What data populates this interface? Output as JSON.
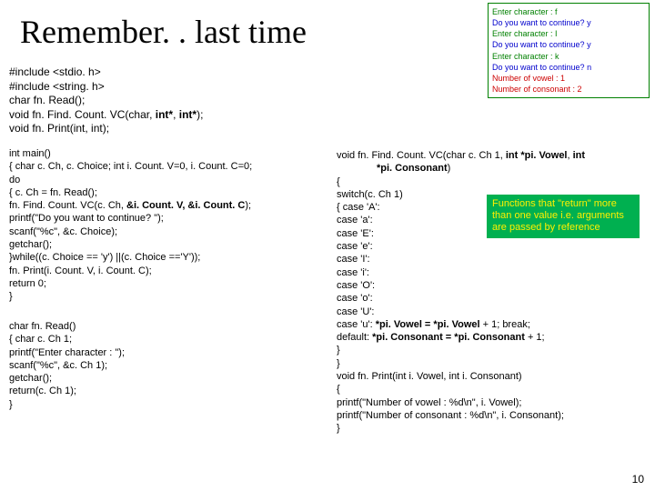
{
  "title": "Remember. . last time",
  "output": {
    "l1": "Enter character : f",
    "l2": "Do you want to continue? y",
    "l3": "Enter character : I",
    "l4": "Do you want to continue? y",
    "l5": "Enter character : k",
    "l6": "Do you want to continue? n",
    "l7": "Number of vowel : 1",
    "l8": "Number of consonant : 2"
  },
  "decl": {
    "l1": "#include <stdio. h>",
    "l2": "#include <string. h>",
    "l3": "char fn. Read();",
    "l4a": "void fn. Find. Count. VC(char, ",
    "l4b": "int*",
    "l4c": ", ",
    "l4d": "int*",
    "l4e": ");",
    "l5": "void fn. Print(int, int);"
  },
  "main": {
    "l1": "int main()",
    "l2": "{   char c. Ch, c. Choice; int i. Count. V=0, i. Count. C=0;",
    "l3": "      do",
    "l4": "      {   c. Ch = fn. Read();",
    "l5a": "          fn. Find. Count. VC(c. Ch, ",
    "l5b": "&i. Count. V, &i. Count. C",
    "l5c": ");",
    "l6": "          printf(\"Do you want to continue? \");",
    "l7": "          scanf(\"%c\", &c. Choice);",
    "l8": "          getchar();",
    "l9": "      }while((c. Choice == 'y') ||(c. Choice =='Y'));",
    "l10": "      fn. Print(i. Count. V, i. Count. C);",
    "l11": "      return 0;",
    "l12": "}"
  },
  "read": {
    "l1": "char fn. Read()",
    "l2": "{    char c. Ch 1;",
    "l3": "      printf(\"Enter character : \");",
    "l4": "      scanf(\"%c\", &c. Ch 1);",
    "l5": "      getchar();",
    "l6": "      return(c. Ch 1);",
    "l7": "}"
  },
  "right": {
    "sig1": "void fn. Find. Count. VC(char c. Ch 1, ",
    "sig2": "int *pi. Vowel",
    "sig3": ", ",
    "sig4": "int",
    "sig5": "*pi. Consonant",
    "sig6": ")",
    "l2": "{",
    "l3": "       switch(c. Ch 1)",
    "l4": "       {     case 'A':",
    "l5": "              case 'a':",
    "l6": "              case 'E':",
    "l7": "              case 'e':",
    "l8": "              case 'I':",
    "l9": "              case 'i':",
    "l10": "              case 'O':",
    "l11": "              case 'o':",
    "l12": "              case 'U':",
    "l13a": "              case 'u': ",
    "l13b": "*pi. Vowel = *pi. Vowel ",
    "l13c": "+ 1; break;",
    "l14a": "              default: ",
    "l14b": "*pi. Consonant = *pi. Consonant ",
    "l14c": "+ 1;",
    "l15": "       }",
    "l16": "}",
    "l17": "void fn. Print(int i. Vowel, int i. Consonant)",
    "l18": "{",
    "l19": "       printf(\"Number of vowel : %d\\n\", i. Vowel);",
    "l20": "       printf(\"Number of consonant : %d\\n\", i. Consonant);",
    "l21": "}"
  },
  "callout": "Functions that \"return\" more than one value i.e. arguments are passed by reference",
  "pagenum": "10"
}
